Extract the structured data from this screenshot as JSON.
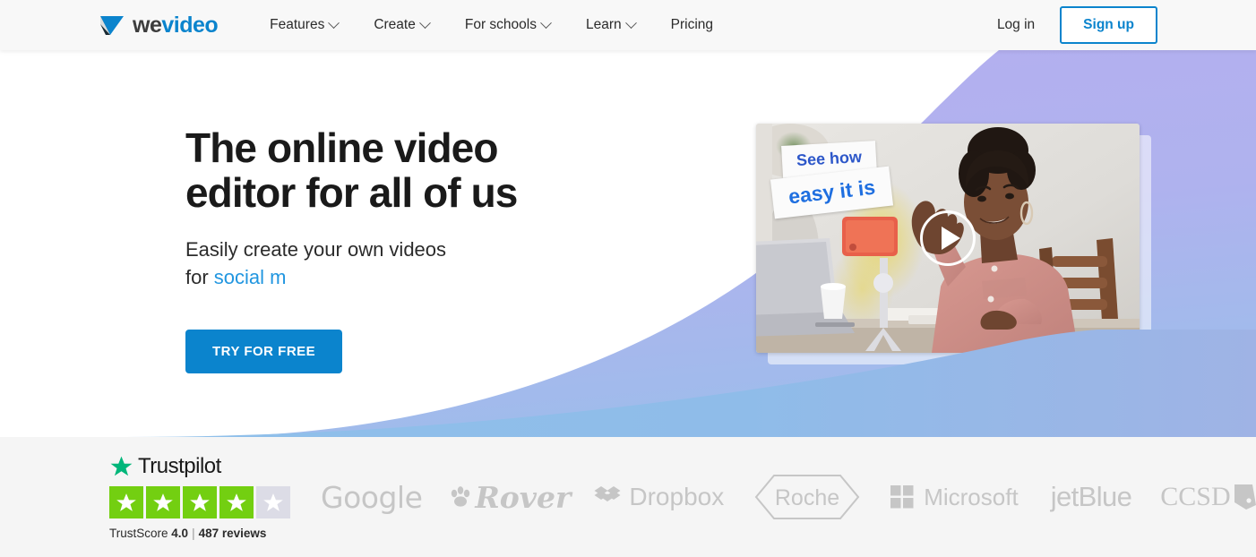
{
  "header": {
    "logo": {
      "icon": "wevideo-play-logo-icon",
      "text_we": "we",
      "text_video": "video"
    },
    "nav": [
      {
        "label": "Features",
        "has_dropdown": true
      },
      {
        "label": "Create",
        "has_dropdown": true
      },
      {
        "label": "For schools",
        "has_dropdown": true
      },
      {
        "label": "Learn",
        "has_dropdown": true
      },
      {
        "label": "Pricing",
        "has_dropdown": false
      }
    ],
    "login_label": "Log in",
    "signup_label": "Sign up"
  },
  "hero": {
    "title_line1": "The online video",
    "title_line2": "editor for all of us",
    "subtitle_prefix": "Easily create your own videos",
    "subtitle_line2_prefix": "for ",
    "subtitle_accent": "social m",
    "cta_label": "TRY FOR FREE",
    "video": {
      "tag_line1": "See how",
      "tag_line2": "easy it is",
      "play_icon": "play-triangle-icon",
      "alt": "Woman recording video with phone on tripod at desk"
    }
  },
  "trustbar": {
    "trustpilot": {
      "name": "Trustpilot",
      "star_icon": "trustpilot-star-icon",
      "stars_filled": 4,
      "stars_total": 5,
      "score_label": "TrustScore",
      "score": "4.0",
      "separator": "|",
      "reviews": "487 reviews"
    },
    "brands": [
      {
        "name": "Google"
      },
      {
        "name": "Rover"
      },
      {
        "name": "Dropbox"
      },
      {
        "name": "Roche"
      },
      {
        "name": "Microsoft"
      },
      {
        "name": "jetBlue"
      },
      {
        "name": "CCSD"
      }
    ]
  },
  "colors": {
    "brand_blue": "#0b84cd",
    "accent_blue": "#2196e0",
    "gradient_top": "#b5aff0",
    "gradient_bottom": "#a6bde9",
    "trustpilot_green": "#00b67a",
    "star_green": "#73cf11",
    "star_gray": "#dcdce6",
    "header_bg": "#f8f8f8",
    "trustbar_bg": "#f5f5f5"
  }
}
